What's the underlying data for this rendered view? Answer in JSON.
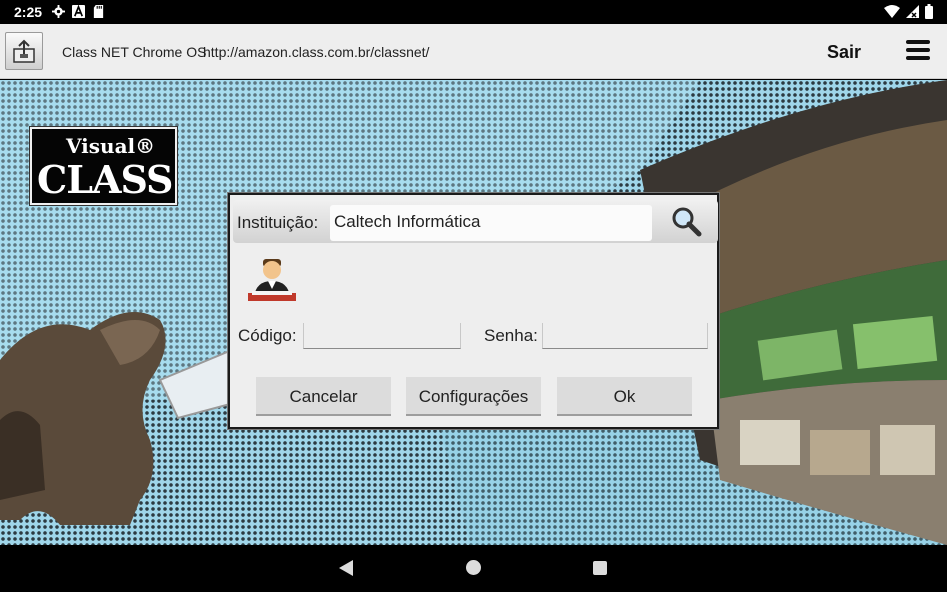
{
  "status_bar": {
    "time": "2:25",
    "left_icons": [
      "gear-icon",
      "a-icon",
      "sd-card-icon"
    ],
    "right_icons": [
      "wifi-icon",
      "signal-icon",
      "battery-icon"
    ]
  },
  "app_bar": {
    "title": "Class NET Chrome OS",
    "url": "http://amazon.class.com.br/classnet/",
    "logout_label": "Sair"
  },
  "logo": {
    "line1": "Visual®",
    "line2": "CLASS"
  },
  "dialog": {
    "institution_label": "Instituição:",
    "institution_value": "Caltech Informática",
    "code_label": "Código:",
    "code_value": "",
    "password_label": "Senha:",
    "password_value": "",
    "buttons": {
      "cancel": "Cancelar",
      "settings": "Configurações",
      "ok": "Ok"
    }
  },
  "colors": {
    "background_dots": "#2d3b42",
    "background_sky": "#9fd6ea",
    "dialog_bg": "#eeeeee",
    "button_bg": "#dcdcdc"
  }
}
